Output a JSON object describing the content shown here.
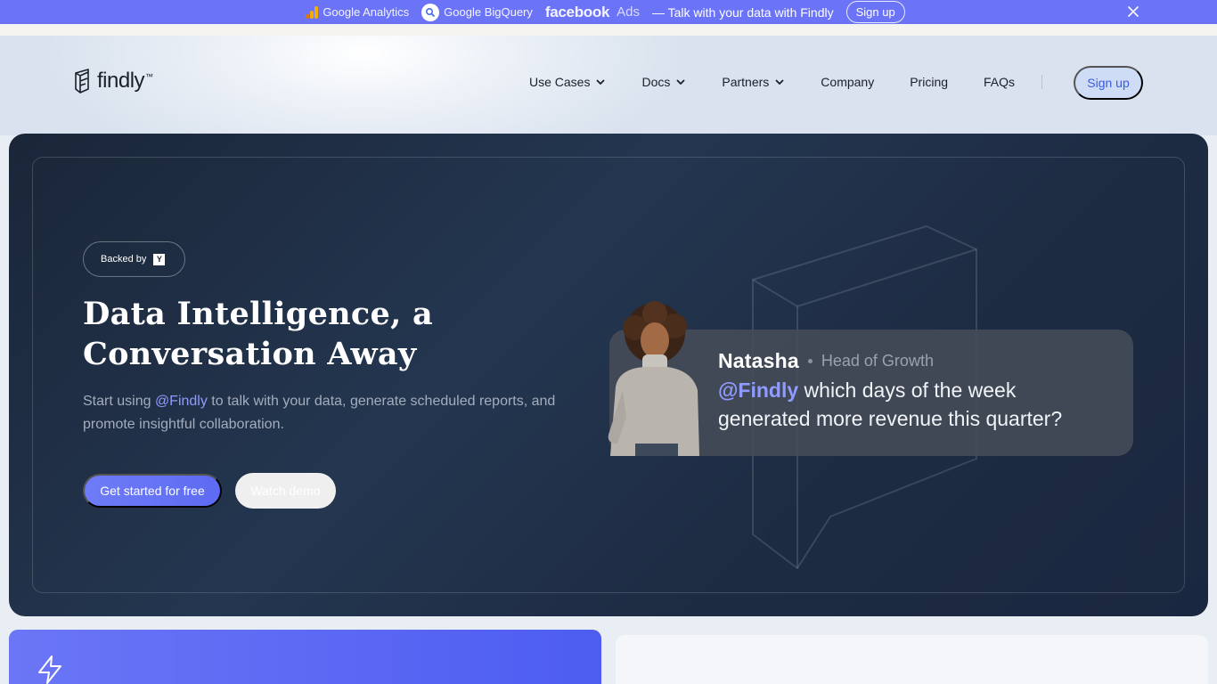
{
  "announcement": {
    "brands": [
      "Google Analytics",
      "Google BigQuery",
      "facebook",
      "Ads"
    ],
    "text": "— Talk with your data with Findly",
    "signup_label": "Sign up"
  },
  "header": {
    "logo_text": "findly",
    "logo_tm": "™",
    "nav": [
      {
        "label": "Use Cases",
        "dropdown": true
      },
      {
        "label": "Docs",
        "dropdown": true
      },
      {
        "label": "Partners",
        "dropdown": true
      },
      {
        "label": "Company",
        "dropdown": false
      },
      {
        "label": "Pricing",
        "dropdown": false
      },
      {
        "label": "FAQs",
        "dropdown": false
      }
    ],
    "signup_label": "Sign up"
  },
  "hero": {
    "backed_by": "Backed by",
    "yc_letter": "Y",
    "title_line1": "Data Intelligence, a",
    "title_line2": "Conversation Away",
    "sub_before": "Start using ",
    "sub_mention": "@Findly",
    "sub_after": " to talk with your data, generate scheduled reports, and promote insightful collaboration.",
    "cta_primary": "Get started for free",
    "cta_secondary": "Watch demo"
  },
  "chat": {
    "name": "Natasha",
    "role": "Head of Growth",
    "mention": "@Findly",
    "message": " which days of the week generated more revenue this quarter?"
  },
  "colors": {
    "accent": "#6b73f6",
    "hero_bg": "#1d2b42",
    "mention": "#8f9bff",
    "nav_signup_bg": "#cfdcf5"
  }
}
